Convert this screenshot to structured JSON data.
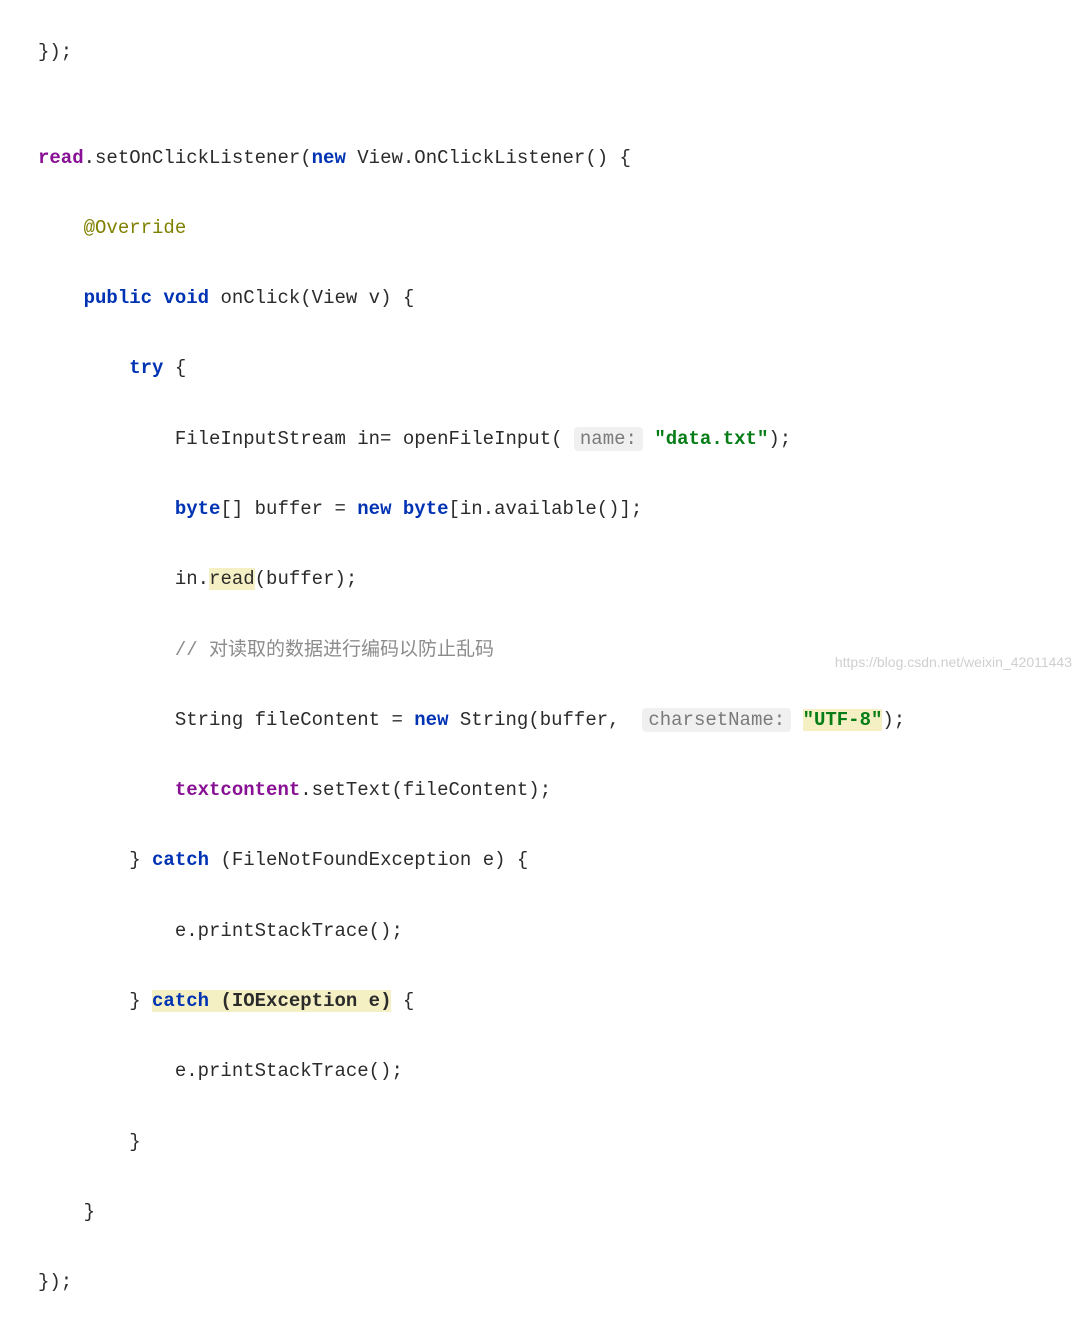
{
  "code": {
    "l0_a": "});",
    "l0_b": "",
    "l1_read": "read",
    "l1_a": ".setOnClickListener(",
    "l1_new": "new",
    "l1_b": " View.OnClickListener() {",
    "l2_anno": "@Override",
    "l3_pub": "public",
    "l3_void": " void",
    "l3_a": " onClick(View v) {",
    "l4_try": "try",
    "l4_a": " {",
    "l5_a": "FileInputStream in= openFileInput( ",
    "l5_hint": "name:",
    "l5_sp": " ",
    "l5_str": "\"data.txt\"",
    "l5_b": ");",
    "l6_byte": "byte",
    "l6_a": "[] buffer = ",
    "l6_new": "new",
    "l6_sp": " ",
    "l6_byte2": "byte",
    "l6_b": "[in.available()];",
    "l7_a": "in.",
    "l7_read": "read",
    "l7_b": "(buffer);",
    "l8_comment": "// 对读取的数据进行编码以防止乱码",
    "l9_a": "String fileContent = ",
    "l9_new": "new",
    "l9_b": " String(buffer,  ",
    "l9_hint": "charsetName:",
    "l9_sp": " ",
    "l9_str": "\"UTF-8\"",
    "l9_c": ");",
    "l10_tc": "textcontent",
    "l10_a": ".setText(fileContent);",
    "l11_a": "} ",
    "l11_catch": "catch",
    "l11_b": " (FileNotFoundException e) {",
    "l12_a": "e.printStackTrace();",
    "l13_a": "} ",
    "l13_catch": "catch",
    "l13_b": " (IOException e)",
    "l13_c": " {",
    "l14_a": "e.printStackTrace();",
    "l15_a": "}",
    "l16_a": "}",
    "l17_a": "});"
  },
  "watermark": "https://blog.csdn.net/weixin_42011443"
}
